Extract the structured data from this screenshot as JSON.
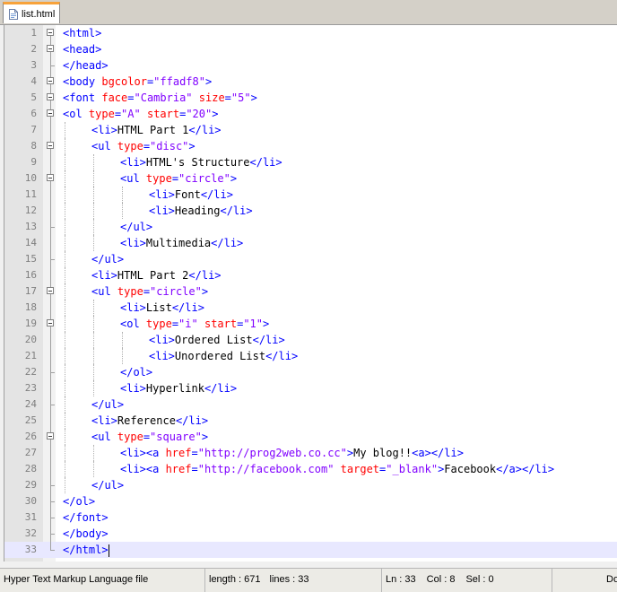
{
  "tab": {
    "label": "list.html",
    "icon": "file-icon"
  },
  "colors": {
    "tag": "#0000ff",
    "attr": "#ff0000",
    "value": "#8000ff",
    "text": "#000000",
    "tab_accent": "#f7a23a"
  },
  "editor": {
    "current_line": 33,
    "lines": [
      {
        "n": "1",
        "indent": 0,
        "fold": "box",
        "tokens": [
          [
            "tag",
            "<html>"
          ]
        ]
      },
      {
        "n": "2",
        "indent": 0,
        "fold": "box",
        "tokens": [
          [
            "tag",
            "<head>"
          ]
        ]
      },
      {
        "n": "3",
        "indent": 0,
        "fold": "end",
        "tokens": [
          [
            "tag",
            "</head>"
          ]
        ]
      },
      {
        "n": "4",
        "indent": 0,
        "fold": "box",
        "tokens": [
          [
            "tag",
            "<body "
          ],
          [
            "attr",
            "bgcolor"
          ],
          [
            "tag",
            "="
          ],
          [
            "val",
            "\"ffadf8\""
          ],
          [
            "tag",
            ">"
          ]
        ]
      },
      {
        "n": "5",
        "indent": 0,
        "fold": "box",
        "tokens": [
          [
            "tag",
            "<font "
          ],
          [
            "attr",
            "face"
          ],
          [
            "tag",
            "="
          ],
          [
            "val",
            "\"Cambria\""
          ],
          [
            "txt",
            " "
          ],
          [
            "attr",
            "size"
          ],
          [
            "tag",
            "="
          ],
          [
            "val",
            "\"5\""
          ],
          [
            "tag",
            ">"
          ]
        ]
      },
      {
        "n": "6",
        "indent": 0,
        "fold": "box",
        "tokens": [
          [
            "tag",
            "<ol "
          ],
          [
            "attr",
            "type"
          ],
          [
            "tag",
            "="
          ],
          [
            "val",
            "\"A\""
          ],
          [
            "txt",
            " "
          ],
          [
            "attr",
            "start"
          ],
          [
            "tag",
            "="
          ],
          [
            "val",
            "\"20\""
          ],
          [
            "tag",
            ">"
          ]
        ]
      },
      {
        "n": "7",
        "indent": 1,
        "fold": "line",
        "tokens": [
          [
            "tag",
            "<li>"
          ],
          [
            "txt",
            "HTML Part 1"
          ],
          [
            "tag",
            "</li>"
          ]
        ]
      },
      {
        "n": "8",
        "indent": 1,
        "fold": "box",
        "tokens": [
          [
            "tag",
            "<ul "
          ],
          [
            "attr",
            "type"
          ],
          [
            "tag",
            "="
          ],
          [
            "val",
            "\"disc\""
          ],
          [
            "tag",
            ">"
          ]
        ]
      },
      {
        "n": "9",
        "indent": 2,
        "fold": "line",
        "tokens": [
          [
            "tag",
            "<li>"
          ],
          [
            "txt",
            "HTML's Structure"
          ],
          [
            "tag",
            "</li>"
          ]
        ]
      },
      {
        "n": "10",
        "indent": 2,
        "fold": "box",
        "tokens": [
          [
            "tag",
            "<ul "
          ],
          [
            "attr",
            "type"
          ],
          [
            "tag",
            "="
          ],
          [
            "val",
            "\"circle\""
          ],
          [
            "tag",
            ">"
          ]
        ]
      },
      {
        "n": "11",
        "indent": 3,
        "fold": "line",
        "tokens": [
          [
            "tag",
            "<li>"
          ],
          [
            "txt",
            "Font"
          ],
          [
            "tag",
            "</li>"
          ]
        ]
      },
      {
        "n": "12",
        "indent": 3,
        "fold": "line",
        "tokens": [
          [
            "tag",
            "<li>"
          ],
          [
            "txt",
            "Heading"
          ],
          [
            "tag",
            "</li>"
          ]
        ]
      },
      {
        "n": "13",
        "indent": 2,
        "fold": "end",
        "tokens": [
          [
            "tag",
            "</ul>"
          ]
        ]
      },
      {
        "n": "14",
        "indent": 2,
        "fold": "line",
        "tokens": [
          [
            "tag",
            "<li>"
          ],
          [
            "txt",
            "Multimedia"
          ],
          [
            "tag",
            "</li>"
          ]
        ]
      },
      {
        "n": "15",
        "indent": 1,
        "fold": "end",
        "tokens": [
          [
            "tag",
            "</ul>"
          ]
        ]
      },
      {
        "n": "16",
        "indent": 1,
        "fold": "line",
        "tokens": [
          [
            "tag",
            "<li>"
          ],
          [
            "txt",
            "HTML Part 2"
          ],
          [
            "tag",
            "</li>"
          ]
        ]
      },
      {
        "n": "17",
        "indent": 1,
        "fold": "box",
        "tokens": [
          [
            "tag",
            "<ul "
          ],
          [
            "attr",
            "type"
          ],
          [
            "tag",
            "="
          ],
          [
            "val",
            "\"circle\""
          ],
          [
            "tag",
            ">"
          ]
        ]
      },
      {
        "n": "18",
        "indent": 2,
        "fold": "line",
        "tokens": [
          [
            "tag",
            "<li>"
          ],
          [
            "txt",
            "List"
          ],
          [
            "tag",
            "</li>"
          ]
        ]
      },
      {
        "n": "19",
        "indent": 2,
        "fold": "box",
        "tokens": [
          [
            "tag",
            "<ol "
          ],
          [
            "attr",
            "type"
          ],
          [
            "tag",
            "="
          ],
          [
            "val",
            "\"i\""
          ],
          [
            "txt",
            " "
          ],
          [
            "attr",
            "start"
          ],
          [
            "tag",
            "="
          ],
          [
            "val",
            "\"1\""
          ],
          [
            "tag",
            ">"
          ]
        ]
      },
      {
        "n": "20",
        "indent": 3,
        "fold": "line",
        "tokens": [
          [
            "tag",
            "<li>"
          ],
          [
            "txt",
            "Ordered List"
          ],
          [
            "tag",
            "</li>"
          ]
        ]
      },
      {
        "n": "21",
        "indent": 3,
        "fold": "line",
        "tokens": [
          [
            "tag",
            "<li>"
          ],
          [
            "txt",
            "Unordered List"
          ],
          [
            "tag",
            "</li>"
          ]
        ]
      },
      {
        "n": "22",
        "indent": 2,
        "fold": "end",
        "tokens": [
          [
            "tag",
            "</ol>"
          ]
        ]
      },
      {
        "n": "23",
        "indent": 2,
        "fold": "line",
        "tokens": [
          [
            "tag",
            "<li>"
          ],
          [
            "txt",
            "Hyperlink"
          ],
          [
            "tag",
            "</li>"
          ]
        ]
      },
      {
        "n": "24",
        "indent": 1,
        "fold": "end",
        "tokens": [
          [
            "tag",
            "</ul>"
          ]
        ]
      },
      {
        "n": "25",
        "indent": 1,
        "fold": "line",
        "tokens": [
          [
            "tag",
            "<li>"
          ],
          [
            "txt",
            "Reference"
          ],
          [
            "tag",
            "</li>"
          ]
        ]
      },
      {
        "n": "26",
        "indent": 1,
        "fold": "box",
        "tokens": [
          [
            "tag",
            "<ul "
          ],
          [
            "attr",
            "type"
          ],
          [
            "tag",
            "="
          ],
          [
            "val",
            "\"square\""
          ],
          [
            "tag",
            ">"
          ]
        ]
      },
      {
        "n": "27",
        "indent": 2,
        "fold": "line",
        "tokens": [
          [
            "tag",
            "<li><a "
          ],
          [
            "attr",
            "href"
          ],
          [
            "tag",
            "="
          ],
          [
            "val",
            "\"http://prog2web.co.cc\""
          ],
          [
            "tag",
            ">"
          ],
          [
            "txt",
            "My blog!!"
          ],
          [
            "tag",
            "<a></li>"
          ]
        ]
      },
      {
        "n": "28",
        "indent": 2,
        "fold": "line",
        "tokens": [
          [
            "tag",
            "<li><a "
          ],
          [
            "attr",
            "href"
          ],
          [
            "tag",
            "="
          ],
          [
            "val",
            "\"http://facebook.com\""
          ],
          [
            "txt",
            " "
          ],
          [
            "attr",
            "target"
          ],
          [
            "tag",
            "="
          ],
          [
            "val",
            "\"_blank\""
          ],
          [
            "tag",
            ">"
          ],
          [
            "txt",
            "Facebook"
          ],
          [
            "tag",
            "</a></li>"
          ]
        ]
      },
      {
        "n": "29",
        "indent": 1,
        "fold": "end",
        "tokens": [
          [
            "tag",
            "</ul>"
          ]
        ]
      },
      {
        "n": "30",
        "indent": 0,
        "fold": "end",
        "tokens": [
          [
            "tag",
            "</ol>"
          ]
        ]
      },
      {
        "n": "31",
        "indent": 0,
        "fold": "end",
        "tokens": [
          [
            "tag",
            "</font>"
          ]
        ]
      },
      {
        "n": "32",
        "indent": 0,
        "fold": "end",
        "tokens": [
          [
            "tag",
            "</body>"
          ]
        ]
      },
      {
        "n": "33",
        "indent": 0,
        "fold": "end",
        "tokens": [
          [
            "tag",
            "</html>"
          ]
        ]
      }
    ]
  },
  "status": {
    "file_type": "Hyper Text Markup Language file",
    "length": "length : 671",
    "lines": "lines : 33",
    "ln": "Ln : 33",
    "col": "Col : 8",
    "sel": "Sel : 0",
    "eol": "Dos\\"
  }
}
